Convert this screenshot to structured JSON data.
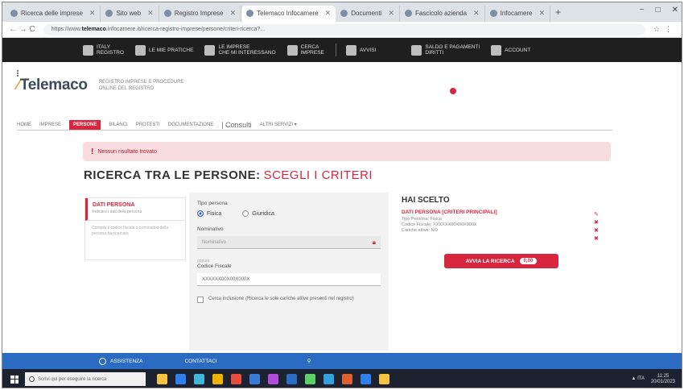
{
  "browser": {
    "tabs": [
      {
        "label": "Ricerca delle imprese",
        "active": false
      },
      {
        "label": "Sito web",
        "active": false
      },
      {
        "label": "Registro Imprese",
        "active": false
      },
      {
        "label": "Telemaco Infocamere",
        "active": true
      },
      {
        "label": "Documenti",
        "active": false
      },
      {
        "label": "Fascicolo azienda",
        "active": false
      },
      {
        "label": "Infocamere",
        "active": false
      }
    ],
    "new_tab": "+",
    "window_controls": [
      "−",
      "□",
      "✕"
    ],
    "url_host": "telemaco",
    "url_prefix": "https://www.",
    "url_rest": ".infocamere.it/ricerca-registro-imprese/persone/criteri-ricerca?...",
    "nav_arrows": "← → C"
  },
  "sitebar": {
    "items": [
      {
        "label": "ITALY\nREGISTRO",
        "icon": "italy-flag-icon"
      },
      {
        "label": "LE MIE PRATICHE",
        "icon": "folder-icon"
      },
      {
        "label": "LE IMPRESE\nCHE MI INTERESSANO",
        "icon": "building-icon"
      },
      {
        "label": "CERCA\nIMPRESE",
        "icon": "search-icon"
      },
      {
        "label": "AVVISI",
        "icon": "bell-icon"
      },
      {
        "label": "SALDO E PAGAMENTI\nDIRITTI",
        "icon": "wallet-icon"
      },
      {
        "label": "ACCOUNT",
        "icon": "user-icon"
      }
    ]
  },
  "logo": {
    "text": "Telemaco",
    "sub1": "REGISTRO IMPRESE E PROCEDURE",
    "sub2": "ONLINE DEL REGISTRO"
  },
  "mainnav": {
    "items": [
      {
        "label": "HOME",
        "active": false
      },
      {
        "label": "IMPRESE",
        "active": false
      },
      {
        "label": "PERSONE",
        "active": true
      },
      {
        "label": "BILANCI",
        "active": false
      },
      {
        "label": "PROTESTI",
        "active": false
      },
      {
        "label": "DOCUMENTAZIONE",
        "active": false
      },
      {
        "label": "| Consulti",
        "active": false,
        "big": true
      },
      {
        "label": "ALTRI SERVIZI ▾",
        "active": false
      }
    ]
  },
  "alert": {
    "icon": "!",
    "text": "Nessun risultato trovato"
  },
  "heading": {
    "main": "RICERCA TRA LE PERSONE:",
    "highlight": "SCEGLI I CRITERI"
  },
  "steps": {
    "active_title": "DATI PERSONA",
    "active_sub": "Indicare i dati della persona",
    "desc": "Compila il codice fiscale o nominativo della persona da ricercare"
  },
  "form": {
    "type_label": "Tipo persona",
    "radio_fisica": "Fisica",
    "radio_giuridica": "Giuridica",
    "nominativo_label": "Nominativo",
    "nominativo_placeholder": "Nominativo",
    "cf_hint": "oppure",
    "cf_label": "Codice Fiscale",
    "cf_value": "XXXXXX00X00X000X",
    "check_text": "Cerca inclusione (Ricerca le sole cariche attive presenti nel registro)"
  },
  "selected": {
    "title": "HAI SCELTO",
    "head": "DATI PERSONA [CRITERI PRINCIPALI]",
    "lines": [
      "Tipo Persona: Fisica",
      "Codice Fiscale: XXXXXX00X00X000X",
      "Cariche attive: NO"
    ],
    "edit_icons": [
      "✎",
      "✖",
      "✖",
      "✖"
    ]
  },
  "search_button": {
    "label": "AVVIA LA RICERCA",
    "badge": "0,00"
  },
  "bluebar": {
    "items": [
      "ASSISTENZA",
      "CONTATTACI",
      ""
    ]
  },
  "taskbar": {
    "search_placeholder": "Scrivi qui per eseguire la ricerca",
    "icon_colors": [
      "#f5c242",
      "#2f80ed",
      "#3db8d9",
      "#f0b400",
      "#e74c3c",
      "#3a7bd5",
      "#b24bdb",
      "#2b6bc1",
      "#5fd068",
      "#35a0e0",
      "#e06030",
      "#2f80ed",
      "#f5c242"
    ],
    "tray_text": "▲ ITA",
    "time": "11:25",
    "date": "20/01/2023"
  }
}
